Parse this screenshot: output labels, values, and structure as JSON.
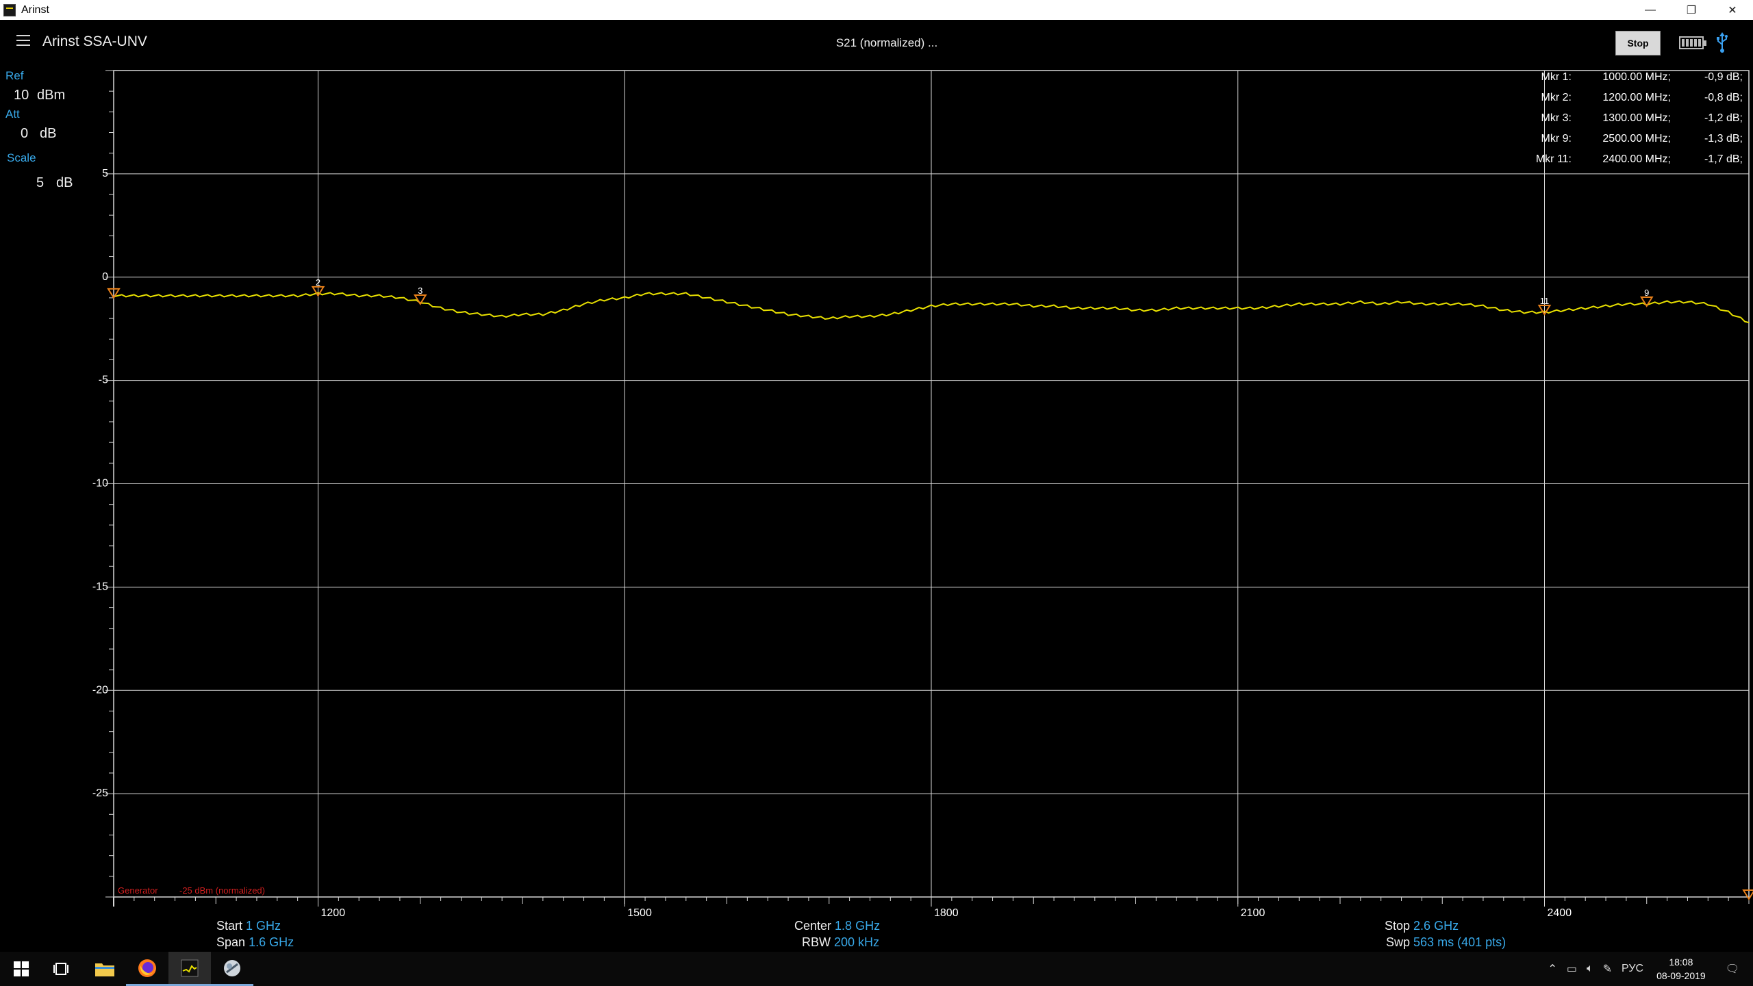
{
  "window": {
    "title": "Arinst",
    "minimize": "—",
    "restore": "❐",
    "close": "✕"
  },
  "header": {
    "app_title": "Arinst SSA-UNV",
    "mode_title": "S21 (normalized) ...",
    "stop_label": "Stop"
  },
  "left_panel": {
    "ref_label": "Ref",
    "ref_value": "10",
    "ref_unit": "dBm",
    "att_label": "Att",
    "att_value": "0",
    "att_unit": "dB",
    "scale_label": "Scale",
    "scale_value": "5",
    "scale_unit": "dB"
  },
  "markers_table": [
    {
      "name": "Mkr 1:",
      "freq": "1000.00 MHz;",
      "value": "-0,9 dB;"
    },
    {
      "name": "Mkr 2:",
      "freq": "1200.00 MHz;",
      "value": "-0,8 dB;"
    },
    {
      "name": "Mkr 3:",
      "freq": "1300.00 MHz;",
      "value": "-1,2 dB;"
    },
    {
      "name": "Mkr 9:",
      "freq": "2500.00 MHz;",
      "value": "-1,3 dB;"
    },
    {
      "name": "Mkr 11:",
      "freq": "2400.00 MHz;",
      "value": "-1,7 dB;"
    }
  ],
  "generator": {
    "label": "Generator",
    "value": "-25 dBm (normalized)"
  },
  "bottom_info": {
    "start_label": "Start",
    "start_value": "1 GHz",
    "span_label": "Span",
    "span_value": "1.6 GHz",
    "center_label": "Center",
    "center_value": "1.8 GHz",
    "rbw_label": "RBW",
    "rbw_value": "200 kHz",
    "stop_label": "Stop",
    "stop_value": "2.6 GHz",
    "swp_label": "Swp",
    "swp_value": "563",
    "swp_unit": "ms (401 pts)"
  },
  "taskbar": {
    "clock_time": "18:08",
    "clock_date": "08-09-2019",
    "language": "РУС",
    "apps": [
      "windows-start",
      "task-view",
      "file-explorer",
      "firefox",
      "arinst",
      "app-5"
    ]
  },
  "colors": {
    "trace": "#e8e000",
    "marker": "#e8801a",
    "accent": "#38a8e8",
    "grid": "#d8d8d8"
  },
  "chart_data": {
    "type": "line",
    "title": "S21 (normalized) ...",
    "xlim": [
      1000,
      2600
    ],
    "ylim": [
      -30,
      10
    ],
    "x_ticks": [
      1200,
      1500,
      1800,
      2100,
      2400
    ],
    "y_ticks": [
      5,
      0,
      -5,
      -10,
      -15,
      -20,
      -25
    ],
    "grid": true,
    "series": [
      {
        "x": [
          1000,
          1020,
          1040,
          1060,
          1080,
          1100,
          1120,
          1140,
          1160,
          1180,
          1200,
          1220,
          1240,
          1260,
          1280,
          1300,
          1320,
          1340,
          1360,
          1380,
          1400,
          1420,
          1440,
          1460,
          1480,
          1500,
          1520,
          1540,
          1560,
          1580,
          1600,
          1620,
          1640,
          1660,
          1680,
          1700,
          1720,
          1740,
          1760,
          1780,
          1800,
          1820,
          1840,
          1860,
          1880,
          1900,
          1920,
          1940,
          1960,
          1980,
          2000,
          2020,
          2040,
          2060,
          2080,
          2100,
          2120,
          2140,
          2160,
          2180,
          2200,
          2220,
          2240,
          2260,
          2280,
          2300,
          2320,
          2340,
          2360,
          2380,
          2400,
          2420,
          2440,
          2460,
          2480,
          2500,
          2520,
          2540,
          2560,
          2580,
          2600
        ],
        "y": [
          -0.9,
          -0.9,
          -0.9,
          -0.9,
          -0.9,
          -0.9,
          -0.9,
          -0.9,
          -0.9,
          -0.9,
          -0.8,
          -0.8,
          -0.9,
          -0.9,
          -1.0,
          -1.2,
          -1.5,
          -1.7,
          -1.8,
          -1.9,
          -1.8,
          -1.8,
          -1.6,
          -1.3,
          -1.1,
          -1.0,
          -0.8,
          -0.8,
          -0.8,
          -1.0,
          -1.2,
          -1.4,
          -1.6,
          -1.8,
          -1.9,
          -2.0,
          -1.9,
          -1.9,
          -1.8,
          -1.6,
          -1.4,
          -1.3,
          -1.3,
          -1.3,
          -1.3,
          -1.4,
          -1.4,
          -1.5,
          -1.5,
          -1.5,
          -1.6,
          -1.6,
          -1.5,
          -1.5,
          -1.5,
          -1.5,
          -1.5,
          -1.4,
          -1.3,
          -1.3,
          -1.3,
          -1.2,
          -1.3,
          -1.2,
          -1.3,
          -1.3,
          -1.3,
          -1.4,
          -1.6,
          -1.7,
          -1.7,
          -1.6,
          -1.5,
          -1.4,
          -1.3,
          -1.3,
          -1.2,
          -1.2,
          -1.3,
          -1.7,
          -2.2
        ]
      }
    ],
    "markers": [
      {
        "label": "",
        "x": 1000,
        "y": -0.9
      },
      {
        "label": "2",
        "x": 1200,
        "y": -0.8
      },
      {
        "label": "3",
        "x": 1300,
        "y": -1.2
      },
      {
        "label": "11",
        "x": 2400,
        "y": -1.7
      },
      {
        "label": "9",
        "x": 2500,
        "y": -1.3
      },
      {
        "label": "",
        "x": 2600,
        "y": -30
      }
    ]
  }
}
